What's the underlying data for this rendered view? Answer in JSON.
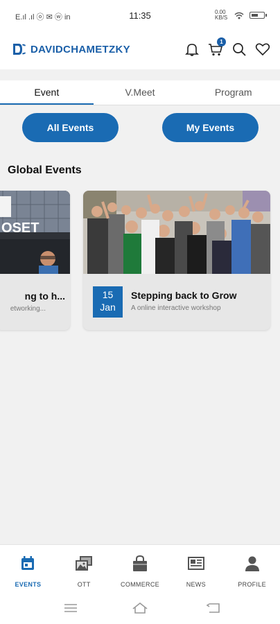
{
  "status_bar": {
    "left_text": "E.ıl .ıl ⓞ ✉ ⓦ in",
    "time": "11:35",
    "net_speed": "0.00 KB/S"
  },
  "header": {
    "logo_text": "DAVIDCHAMETZKY",
    "cart_count": "1",
    "brand_color": "#1a5fa8"
  },
  "tabs": [
    {
      "label": "Event",
      "active": true
    },
    {
      "label": "V.Meet",
      "active": false
    },
    {
      "label": "Program",
      "active": false
    }
  ],
  "segments": {
    "all_events": "All Events",
    "my_events": "My Events"
  },
  "section_title": "Global Events",
  "events": [
    {
      "title": "ng to h...",
      "subtitle": "etworking...",
      "image_text": "OSET"
    },
    {
      "day": "15",
      "month": "Jan",
      "title": "Stepping back to Grow",
      "subtitle": "A online interactive workshop"
    }
  ],
  "bottom_nav": [
    {
      "label": "EVENTS",
      "icon": "calendar-icon",
      "active": true
    },
    {
      "label": "OTT",
      "icon": "images-icon",
      "active": false
    },
    {
      "label": "COMMERCE",
      "icon": "shopping-bag-icon",
      "active": false
    },
    {
      "label": "NEWS",
      "icon": "newspaper-icon",
      "active": false
    },
    {
      "label": "PROFILE",
      "icon": "person-icon",
      "active": false
    }
  ],
  "accent_color": "#1a6bb3"
}
